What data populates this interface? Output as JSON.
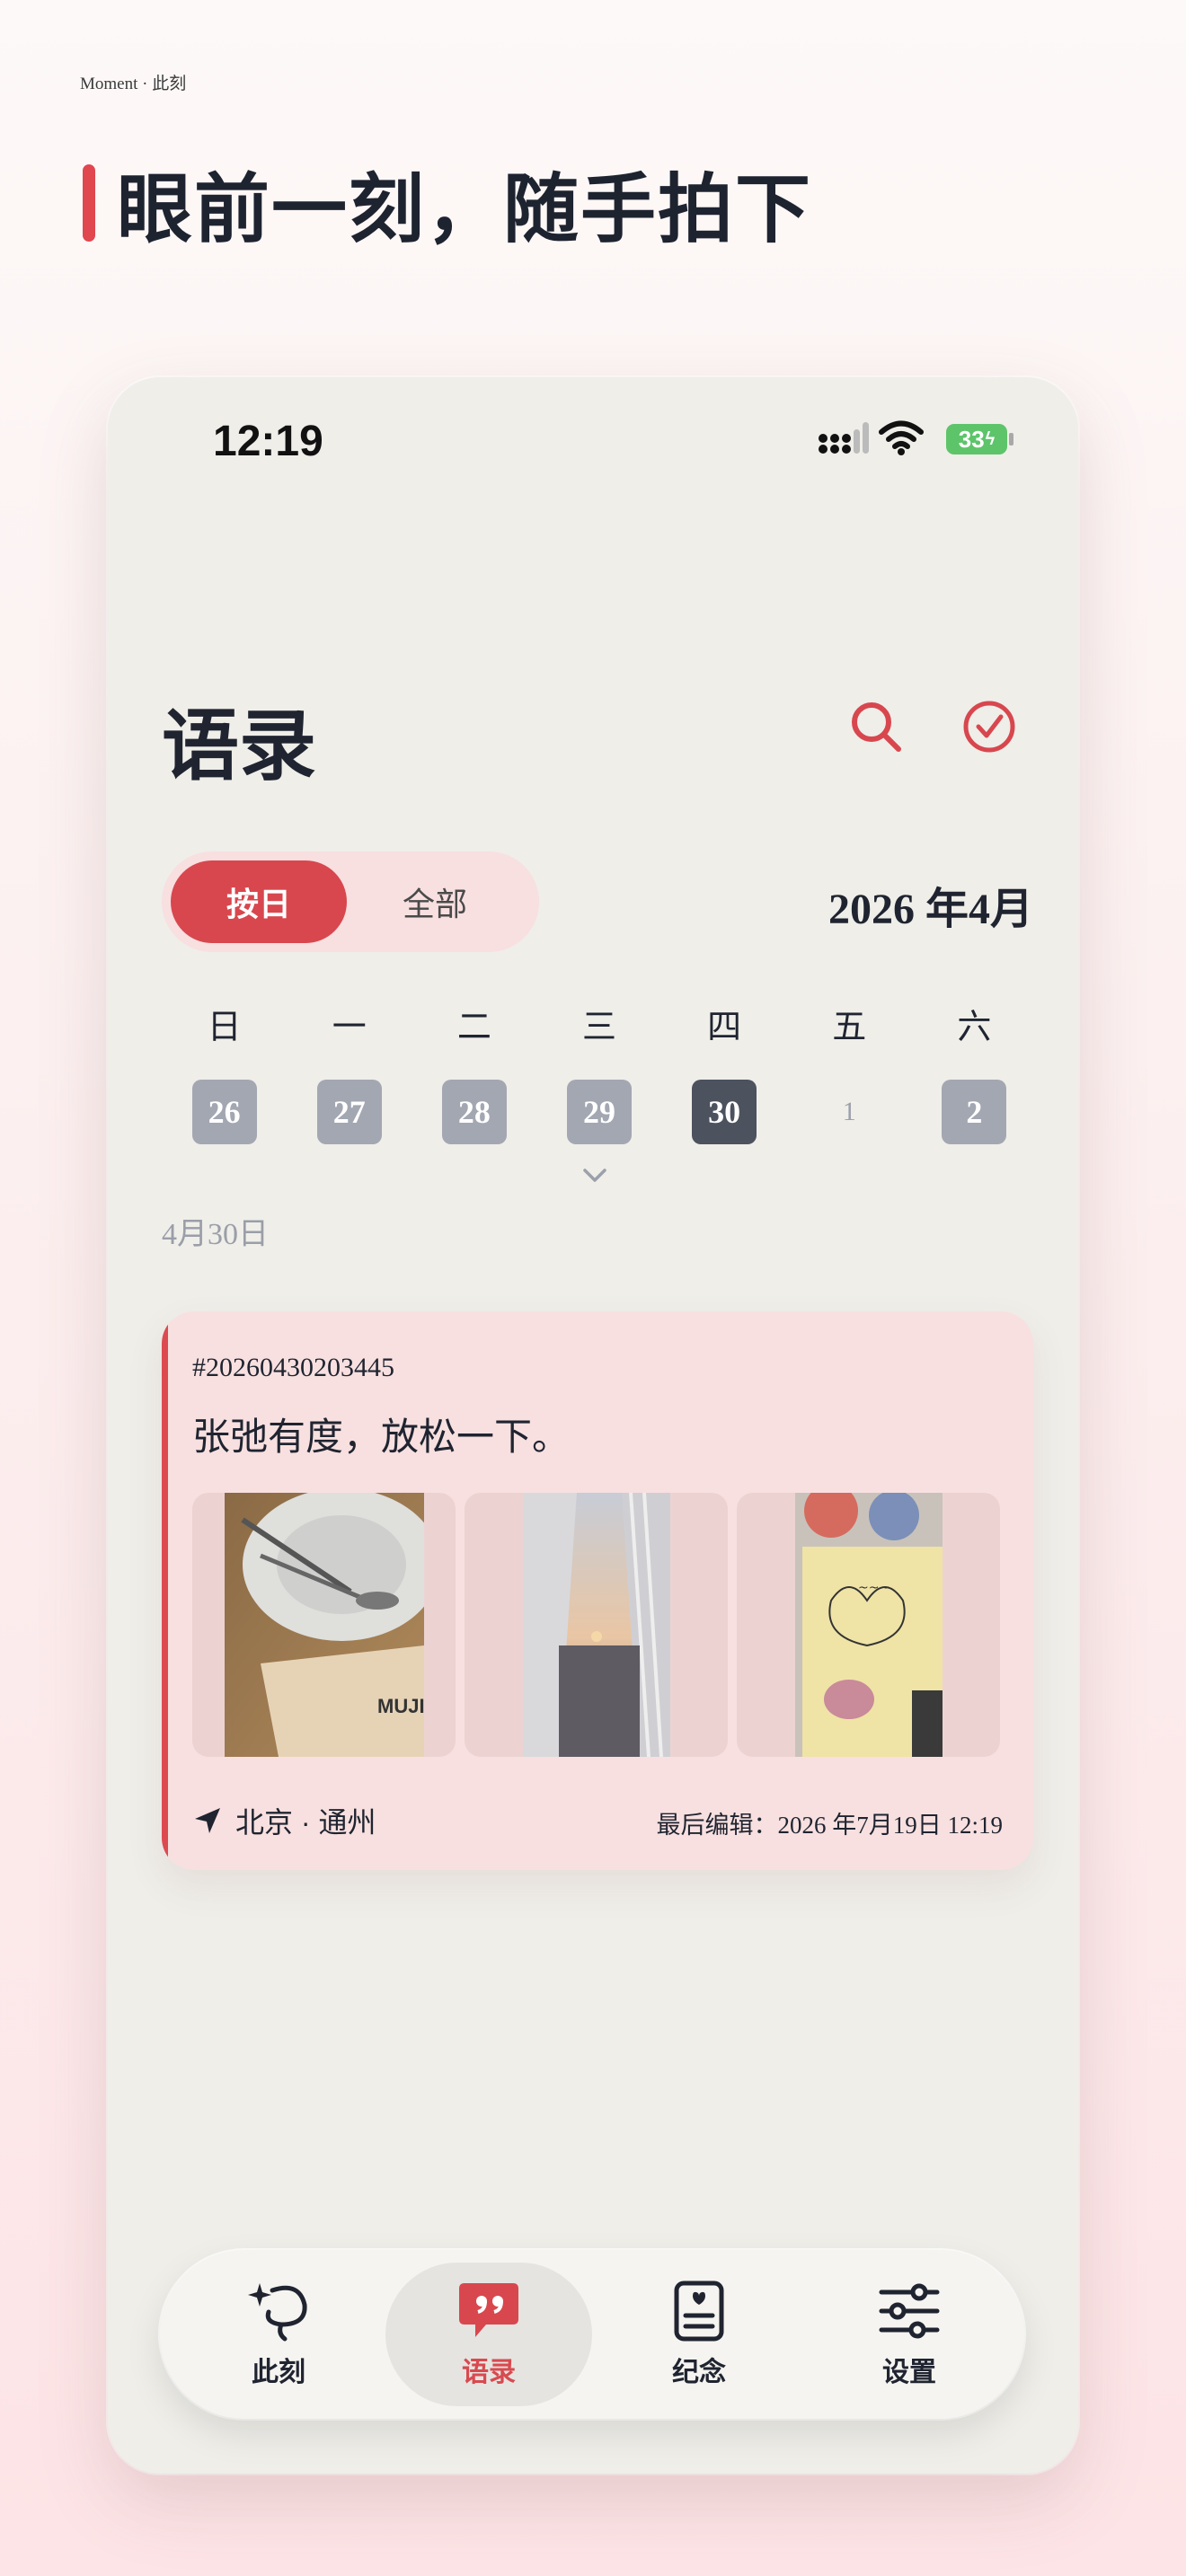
{
  "brand": "Moment · 此刻",
  "headline": "眼前一刻，随手拍下",
  "status_bar": {
    "time": "12:19",
    "battery": "33"
  },
  "page": {
    "title": "语录"
  },
  "toolbar": {
    "search_icon": "search-icon",
    "select_icon": "check-circle-icon"
  },
  "view_toggle": {
    "options": [
      "按日",
      "全部"
    ],
    "selected": "按日"
  },
  "calendar": {
    "month_label": "2026 年4月",
    "weekdays": [
      "日",
      "一",
      "二",
      "三",
      "四",
      "五",
      "六"
    ],
    "days": [
      "26",
      "27",
      "28",
      "29",
      "30",
      "1",
      "2"
    ],
    "today": "30",
    "selected_date_label": "4月30日"
  },
  "entry": {
    "tag": "#20260430203445",
    "text": "张弛有度，放松一下。",
    "photo_count": 3,
    "location": "北京 · 通州",
    "last_edited": "最后编辑：2026  年7月19日 12:19"
  },
  "tabs": [
    {
      "label": "此刻",
      "icon": "sparkle-lasso-icon"
    },
    {
      "label": "语录",
      "icon": "quote-bubble-icon"
    },
    {
      "label": "纪念",
      "icon": "memorial-card-icon"
    },
    {
      "label": "设置",
      "icon": "sliders-icon"
    }
  ],
  "active_tab": "语录",
  "colors": {
    "accent": "#d8474e",
    "card_bg": "#f8e0e0",
    "phone_bg": "#efeee9",
    "today": "#4c525e",
    "day_chip": "#a3a7b2"
  }
}
